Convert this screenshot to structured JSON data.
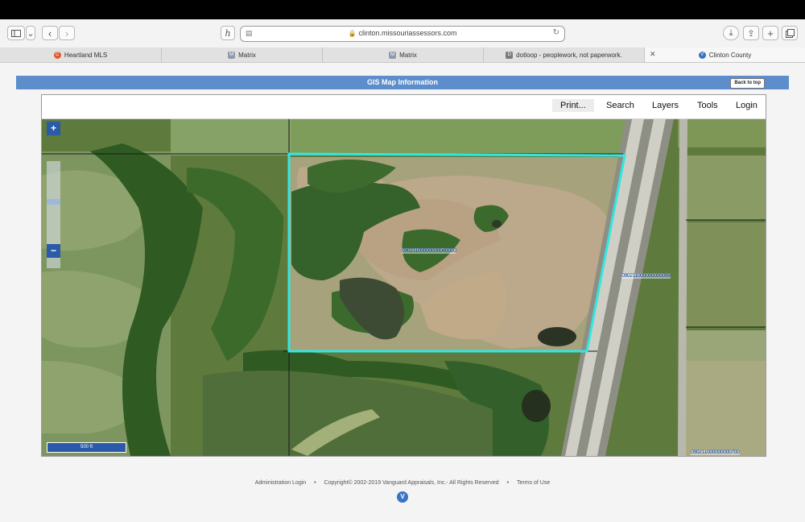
{
  "browser": {
    "url": "clinton.missouriassessors.com",
    "tabs": [
      {
        "label": "Heartland MLS",
        "icon": "heartland-icon",
        "color": "#e15a2b"
      },
      {
        "label": "Matrix",
        "icon": "matrix-icon",
        "color": "#8f9aad"
      },
      {
        "label": "Matrix",
        "icon": "matrix-icon",
        "color": "#8f9aad"
      },
      {
        "label": "dotloop - peoplework, not paperwork.",
        "icon": "dotloop-icon",
        "color": "#7b7b7b"
      },
      {
        "label": "Clinton County",
        "icon": "vanguard-icon",
        "color": "#3b73c4",
        "active": true
      }
    ]
  },
  "page": {
    "header_title": "GIS Map Information",
    "back_to_top": "Back to top"
  },
  "map": {
    "menu": [
      "Print...",
      "Search",
      "Layers",
      "Tools",
      "Login"
    ],
    "zoom_in": "+",
    "zoom_out": "−",
    "scale_label": "500 ft",
    "parcel_ids": [
      "09021100000000040000",
      "090211000000000099",
      "090211000000000700"
    ],
    "highlight_color": "#33e6e0"
  },
  "footer": {
    "admin_login": "Administration Login",
    "copyright": "Copyright© 2002-2019 Vanguard Appraisals, Inc.- All Rights Reserved",
    "terms": "Terms of Use",
    "separator": "•"
  }
}
